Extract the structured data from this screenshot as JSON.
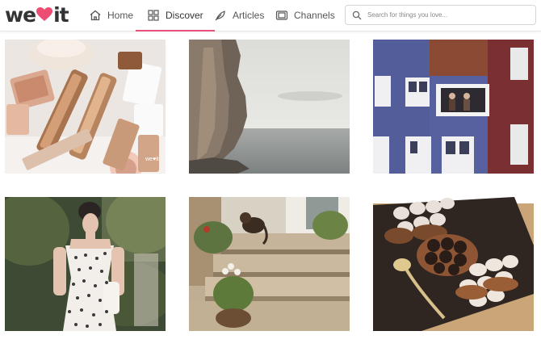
{
  "header": {
    "logo": {
      "left": "we",
      "right": "it",
      "heart_color": "#ee4d73"
    },
    "nav": [
      {
        "label": "Home",
        "icon": "home-icon"
      },
      {
        "label": "Discover",
        "icon": "grid-icon",
        "active": true
      },
      {
        "label": "Articles",
        "icon": "feather-icon"
      },
      {
        "label": "Channels",
        "icon": "tv-icon"
      }
    ],
    "search": {
      "placeholder": "Search for things you love...",
      "value": ""
    }
  },
  "accent_color": "#e8507a",
  "feed": {
    "images": [
      {
        "subject": "makeup products"
      },
      {
        "subject": "seaside cliff"
      },
      {
        "subject": "blue building with window"
      },
      {
        "subject": "woman in polka-dot dress"
      },
      {
        "subject": "cat on stone steps"
      },
      {
        "subject": "chocolates on tray"
      }
    ],
    "watermark": "we♥it"
  }
}
